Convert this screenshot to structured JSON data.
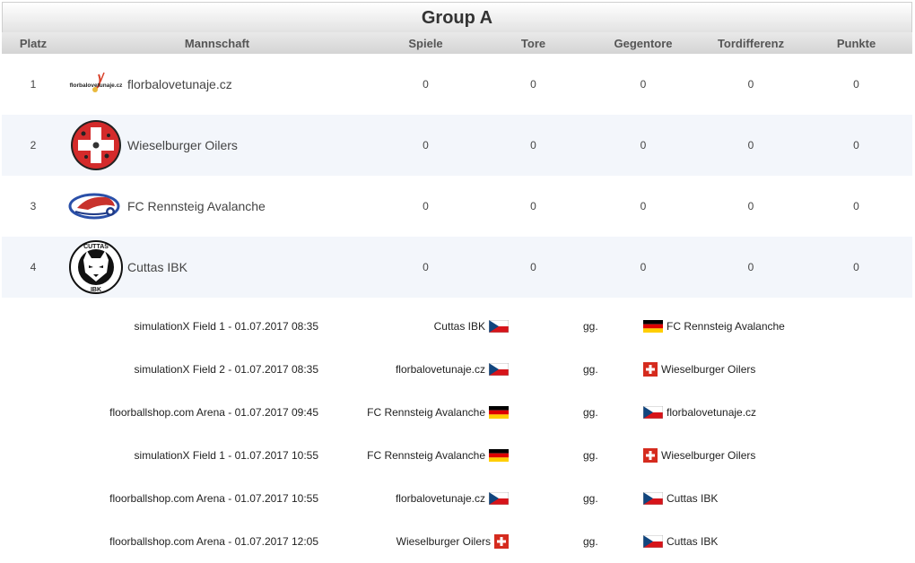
{
  "header": {
    "title": "Group A"
  },
  "columns": [
    "Platz",
    "Mannschaft",
    "Spiele",
    "Tore",
    "Gegentore",
    "Tordifferenz",
    "Punkte"
  ],
  "standings": [
    {
      "place": "1",
      "team": "florbalovetunaje.cz",
      "logo": "florbalovetunaje-logo",
      "logo_text": "florbalovetunaje.cz",
      "games": "0",
      "goals": "0",
      "against": "0",
      "diff": "0",
      "points": "0"
    },
    {
      "place": "2",
      "team": "Wieselburger Oilers",
      "logo": "swiss-cross-logo",
      "games": "0",
      "goals": "0",
      "against": "0",
      "diff": "0",
      "points": "0"
    },
    {
      "place": "3",
      "team": "FC Rennsteig Avalanche",
      "logo": "avalanche-logo",
      "games": "0",
      "goals": "0",
      "against": "0",
      "diff": "0",
      "points": "0"
    },
    {
      "place": "4",
      "team": "Cuttas IBK",
      "logo": "wolf-logo",
      "logo_text_top": "CUTTAS",
      "logo_text_bottom": "IBK",
      "games": "0",
      "goals": "0",
      "against": "0",
      "diff": "0",
      "points": "0"
    }
  ],
  "matches": [
    {
      "venue": "simulationX Field 1 - 01.07.2017 08:35",
      "home": "Cuttas IBK",
      "home_flag": "cz",
      "vs": "gg.",
      "away": "FC Rennsteig Avalanche",
      "away_flag": "de"
    },
    {
      "venue": "simulationX Field 2 - 01.07.2017 08:35",
      "home": "florbalovetunaje.cz",
      "home_flag": "cz",
      "vs": "gg.",
      "away": "Wieselburger Oilers",
      "away_flag": "ch"
    },
    {
      "venue": "floorballshop.com Arena - 01.07.2017 09:45",
      "home": "FC Rennsteig Avalanche",
      "home_flag": "de",
      "vs": "gg.",
      "away": "florbalovetunaje.cz",
      "away_flag": "cz"
    },
    {
      "venue": "simulationX Field 1 - 01.07.2017 10:55",
      "home": "FC Rennsteig Avalanche",
      "home_flag": "de",
      "vs": "gg.",
      "away": "Wieselburger Oilers",
      "away_flag": "ch"
    },
    {
      "venue": "floorballshop.com Arena - 01.07.2017 10:55",
      "home": "florbalovetunaje.cz",
      "home_flag": "cz",
      "vs": "gg.",
      "away": "Cuttas IBK",
      "away_flag": "cz"
    },
    {
      "venue": "floorballshop.com Arena - 01.07.2017 12:05",
      "home": "Wieselburger Oilers",
      "home_flag": "ch",
      "vs": "gg.",
      "away": "Cuttas IBK",
      "away_flag": "cz"
    }
  ]
}
